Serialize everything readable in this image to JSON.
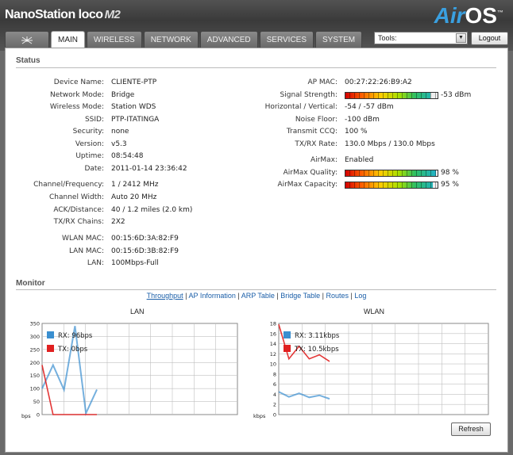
{
  "header": {
    "brand": "NanoStation loco",
    "brand_model": "M2",
    "logo_air": "Air",
    "logo_os": "OS",
    "logo_tm": "™"
  },
  "tabs": [
    {
      "label": "",
      "icon": "ubiquiti-logo-icon"
    },
    {
      "label": "MAIN",
      "active": true
    },
    {
      "label": "WIRELESS"
    },
    {
      "label": "NETWORK"
    },
    {
      "label": "ADVANCED"
    },
    {
      "label": "SERVICES"
    },
    {
      "label": "SYSTEM"
    }
  ],
  "tools": {
    "selected": "Tools:"
  },
  "logout_label": "Logout",
  "status": {
    "title": "Status",
    "left": [
      {
        "label": "Device Name:",
        "value": "CLIENTE-PTP"
      },
      {
        "label": "Network Mode:",
        "value": "Bridge"
      },
      {
        "label": "Wireless Mode:",
        "value": "Station WDS"
      },
      {
        "label": "SSID:",
        "value": "PTP-ITATINGA"
      },
      {
        "label": "Security:",
        "value": "none"
      },
      {
        "label": "Version:",
        "value": "v5.3"
      },
      {
        "label": "Uptime:",
        "value": "08:54:48"
      },
      {
        "label": "Date:",
        "value": "2011-01-14 23:36:42"
      },
      {
        "label": "Channel/Frequency:",
        "value": "1 / 2412 MHz"
      },
      {
        "label": "Channel Width:",
        "value": "Auto 20 MHz"
      },
      {
        "label": "ACK/Distance:",
        "value": "40 / 1.2 miles (2.0 km)"
      },
      {
        "label": "TX/RX Chains:",
        "value": "2X2"
      },
      {
        "label": "WLAN MAC:",
        "value": "00:15:6D:3A:82:F9"
      },
      {
        "label": "LAN MAC:",
        "value": "00:15:6D:3B:82:F9"
      },
      {
        "label": "LAN:",
        "value": "100Mbps-Full"
      }
    ],
    "right": [
      {
        "label": "AP MAC:",
        "value": "00:27:22:26:B9:A2"
      },
      {
        "label": "Signal Strength:",
        "value": "-53 dBm",
        "bar": 0.92
      },
      {
        "label": "Horizontal / Vertical:",
        "value": "-54 / -57 dBm"
      },
      {
        "label": "Noise Floor:",
        "value": "-100 dBm"
      },
      {
        "label": "Transmit CCQ:",
        "value": "100 %"
      },
      {
        "label": "TX/RX Rate:",
        "value": "130.0 Mbps / 130.0 Mbps"
      },
      {
        "label": "AirMax:",
        "value": "Enabled"
      },
      {
        "label": "AirMax Quality:",
        "value": "98 %",
        "bar": 0.98
      },
      {
        "label": "AirMax Capacity:",
        "value": "95 %",
        "bar": 0.95
      }
    ]
  },
  "monitor": {
    "title": "Monitor",
    "links": [
      "Throughput",
      "AP Information",
      "ARP Table",
      "Bridge Table",
      "Routes",
      "Log"
    ],
    "active_link": "Throughput"
  },
  "refresh_label": "Refresh",
  "colors": {
    "rx": "#3a8fd0",
    "tx": "#e02020",
    "grid": "#c0c0c0"
  },
  "chart_data": [
    {
      "type": "line",
      "title": "LAN",
      "unit_label": "bps",
      "ylim": [
        0,
        350
      ],
      "yticks": [
        0,
        50,
        100,
        150,
        200,
        250,
        300,
        350
      ],
      "series": [
        {
          "name": "RX: 96bps",
          "values": [
            100,
            190,
            95,
            340,
            5,
            96
          ]
        },
        {
          "name": "TX: 0bps",
          "values": [
            190,
            0,
            0,
            0,
            0,
            0
          ]
        }
      ]
    },
    {
      "type": "line",
      "title": "WLAN",
      "unit_label": "kbps",
      "ylim": [
        0,
        18
      ],
      "yticks": [
        0,
        2,
        4,
        6,
        8,
        10,
        12,
        14,
        16,
        18
      ],
      "series": [
        {
          "name": "RX: 3.11kbps",
          "values": [
            4.5,
            3.5,
            4.2,
            3.4,
            3.8,
            3.11
          ]
        },
        {
          "name": "TX: 10.5kbps",
          "values": [
            17.8,
            11,
            13.5,
            11,
            11.8,
            10.5
          ]
        }
      ]
    }
  ]
}
